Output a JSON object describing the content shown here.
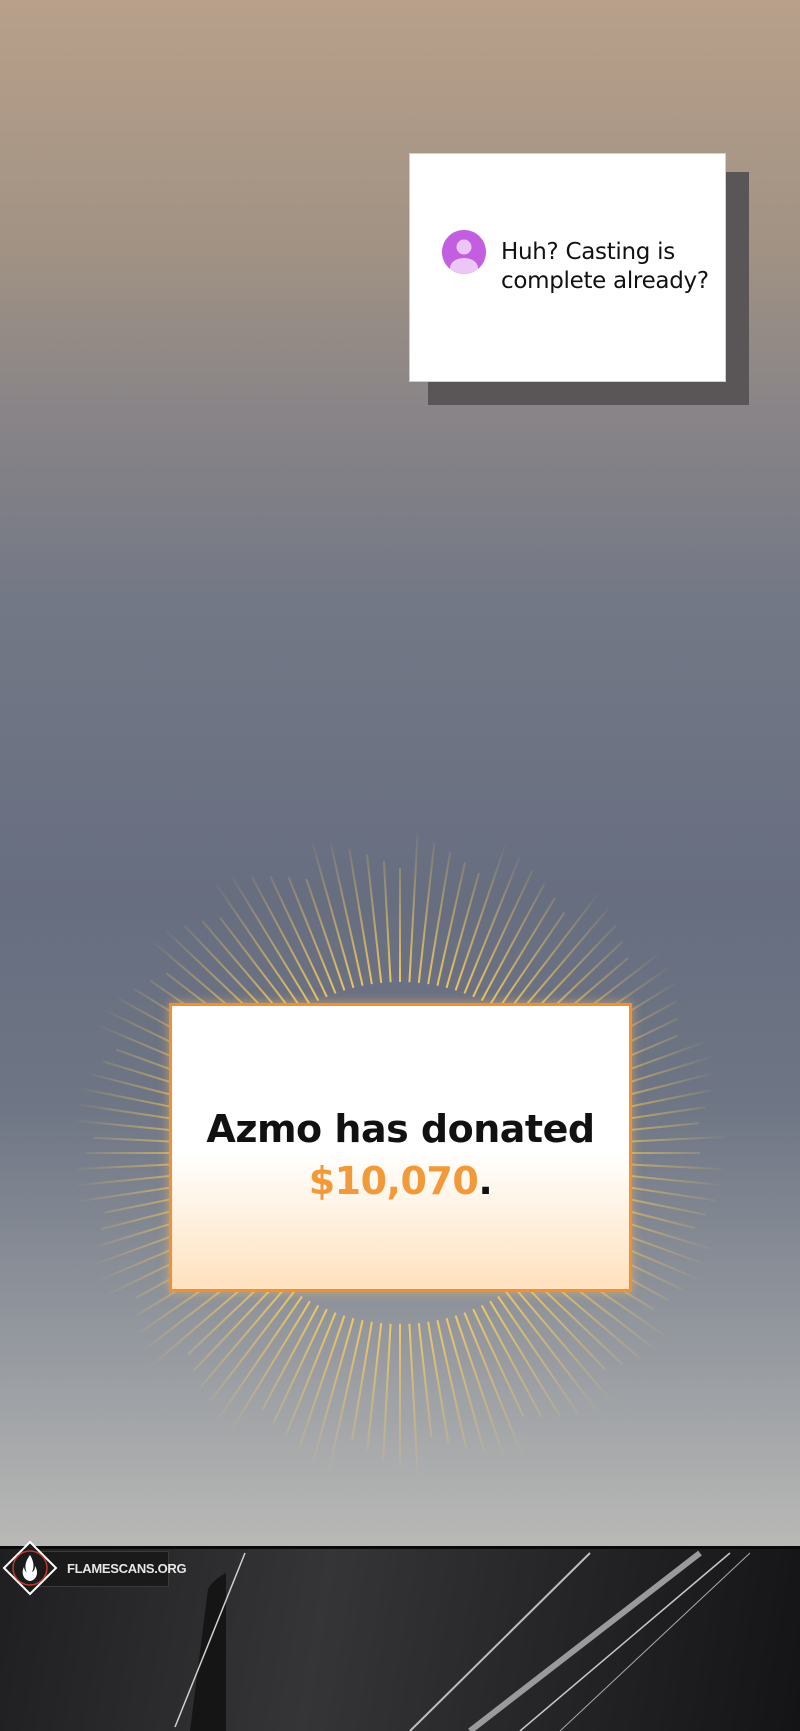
{
  "chat": {
    "message": "Huh? Casting is complete already?",
    "avatar_icon": "user-avatar-icon",
    "avatar_color": "#c45ee0"
  },
  "donation": {
    "donor": "Azmo",
    "text": "has donated",
    "amount": "$10,070",
    "suffix": ".",
    "amount_color": "#f29a3a",
    "border_color": "#f09030"
  },
  "watermark": {
    "site": "FLAMESCANS.ORG",
    "logo_icon": "flame-logo-icon"
  }
}
